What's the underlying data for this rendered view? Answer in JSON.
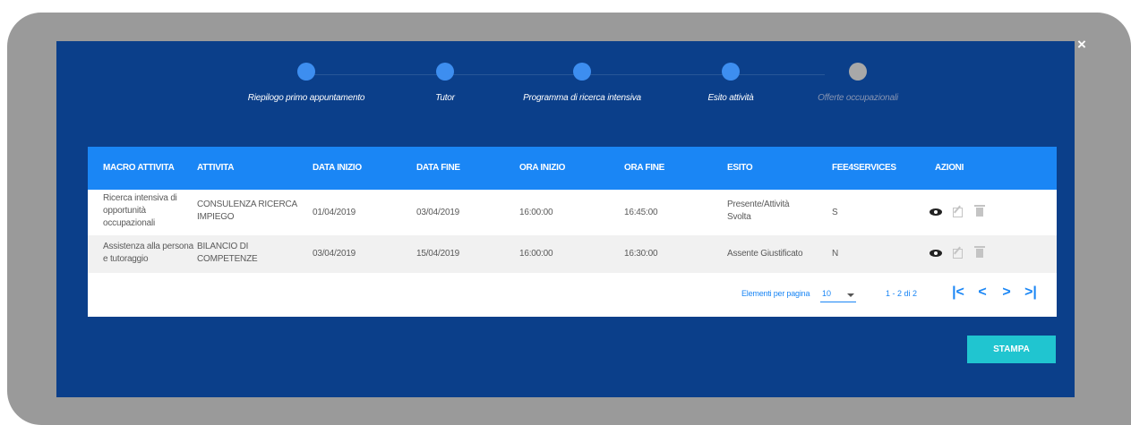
{
  "stepper": {
    "steps": [
      {
        "label": "Riepilogo primo appuntamento",
        "state": "completed"
      },
      {
        "label": "Tutor",
        "state": "completed"
      },
      {
        "label": "Programma di ricerca intensiva",
        "state": "completed"
      },
      {
        "label": "Esito attività",
        "state": "completed"
      },
      {
        "label": "Offerte occupazionali",
        "state": "inactive"
      }
    ]
  },
  "table": {
    "headers": [
      "MACRO ATTIVITA",
      "ATTIVITA",
      "DATA INIZIO",
      "DATA FINE",
      "ORA INIZIO",
      "ORA FINE",
      "ESITO",
      "FEE4SERVICES",
      "AZIONI"
    ],
    "rows": [
      {
        "macro": [
          "Ricerca intensiva di",
          "opportunità",
          "occupazionali"
        ],
        "attivita": [
          "CONSULENZA RICERCA",
          "IMPIEGO"
        ],
        "data_inizio": "01/04/2019",
        "data_fine": "03/04/2019",
        "ora_inizio": "16:00:00",
        "ora_fine": "16:45:00",
        "esito": [
          "Presente/Attività",
          "Svolta"
        ],
        "fee": "S",
        "actions": [
          "eye-icon",
          "edit-icon",
          "trash-icon"
        ]
      },
      {
        "macro": [
          "Assistenza alla persona",
          "e tutoraggio"
        ],
        "attivita": [
          "BILANCIO DI",
          "COMPETENZE"
        ],
        "data_inizio": "03/04/2019",
        "data_fine": "15/04/2019",
        "ora_inizio": "16:00:00",
        "ora_fine": "16:30:00",
        "esito": [
          "Assente Giustificato"
        ],
        "fee": "N",
        "actions": [
          "eye-icon",
          "edit-icon",
          "trash-icon"
        ]
      }
    ]
  },
  "pagination": {
    "label": "Elementi per pagina",
    "page_size": "10",
    "range": "1 - 2 di 2",
    "first": "|<",
    "prev": "<",
    "next": ">",
    "last": ">|"
  },
  "actions": {
    "print_label": "STAMPA",
    "close_label": "×"
  },
  "colors": {
    "modal_bg": "#0b3f8a",
    "header_bg": "#1a86f5",
    "step_active": "#3d8ef0",
    "step_inactive": "#a8a8a8",
    "print_button": "#20c5d0"
  }
}
